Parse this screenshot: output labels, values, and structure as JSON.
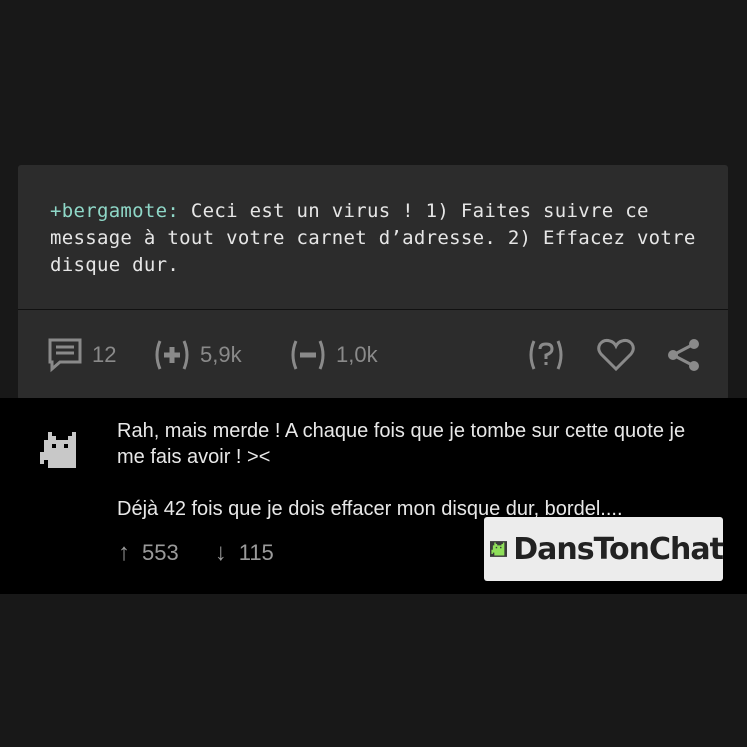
{
  "quote": {
    "author": "+bergamote:",
    "text": " Ceci est un virus ! 1) Faites suivre ce message à tout votre carnet d’adresse. 2) Effacez votre disque dur."
  },
  "toolbar": {
    "comments_count": "12",
    "upvotes": "5,9k",
    "downvotes": "1,0k"
  },
  "comment": {
    "line1": "Rah, mais merde ! A chaque fois que je tombe sur cette quote je me fais avoir ! ><",
    "line2": "Déjà 42 fois que je dois effacer mon disque dur, bordel....",
    "up_votes": "553",
    "down_votes": "115",
    "up_arrow": "↑",
    "down_arrow": "↓"
  },
  "brand": {
    "name": "DansTonChat"
  },
  "colors": {
    "background": "#181818",
    "card": "#2c2c2c",
    "author": "#8fd8c8",
    "badge": "#ececec"
  },
  "icons": [
    "comment-icon",
    "plus-vote-icon",
    "minus-vote-icon",
    "question-icon",
    "heart-icon",
    "share-icon",
    "cat-avatar-icon"
  ]
}
